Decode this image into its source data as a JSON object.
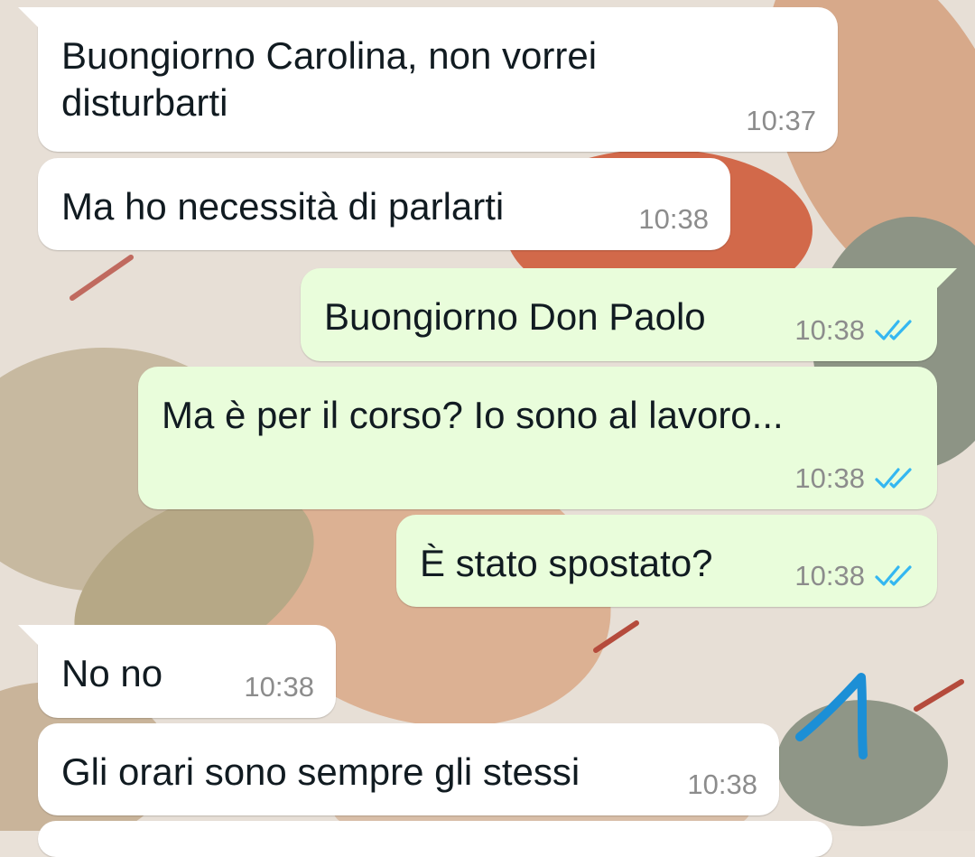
{
  "messages": [
    {
      "direction": "in",
      "text": "Buongiorno Carolina, non vorrei disturbarti",
      "time": "10:37"
    },
    {
      "direction": "in",
      "text": "Ma ho necessità di parlarti",
      "time": "10:38"
    },
    {
      "direction": "out",
      "text": "Buongiorno Don Paolo",
      "time": "10:38",
      "status": "read"
    },
    {
      "direction": "out",
      "text": "Ma è per il corso? Io sono al lavoro...",
      "time": "10:38",
      "status": "read"
    },
    {
      "direction": "out",
      "text": "È stato spostato?",
      "time": "10:38",
      "status": "read"
    },
    {
      "direction": "in",
      "text": "No no",
      "time": "10:38"
    },
    {
      "direction": "in",
      "text": "Gli orari sono sempre gli stessi",
      "time": "10:38"
    }
  ],
  "colors": {
    "incoming_bubble": "#ffffff",
    "outgoing_bubble": "#e9fddb",
    "read_ticks": "#34b7f1",
    "annotation": "#1c8fd6"
  },
  "icons": {
    "read_receipt": "double-check-icon",
    "annotation": "hand-drawn-arrow"
  }
}
